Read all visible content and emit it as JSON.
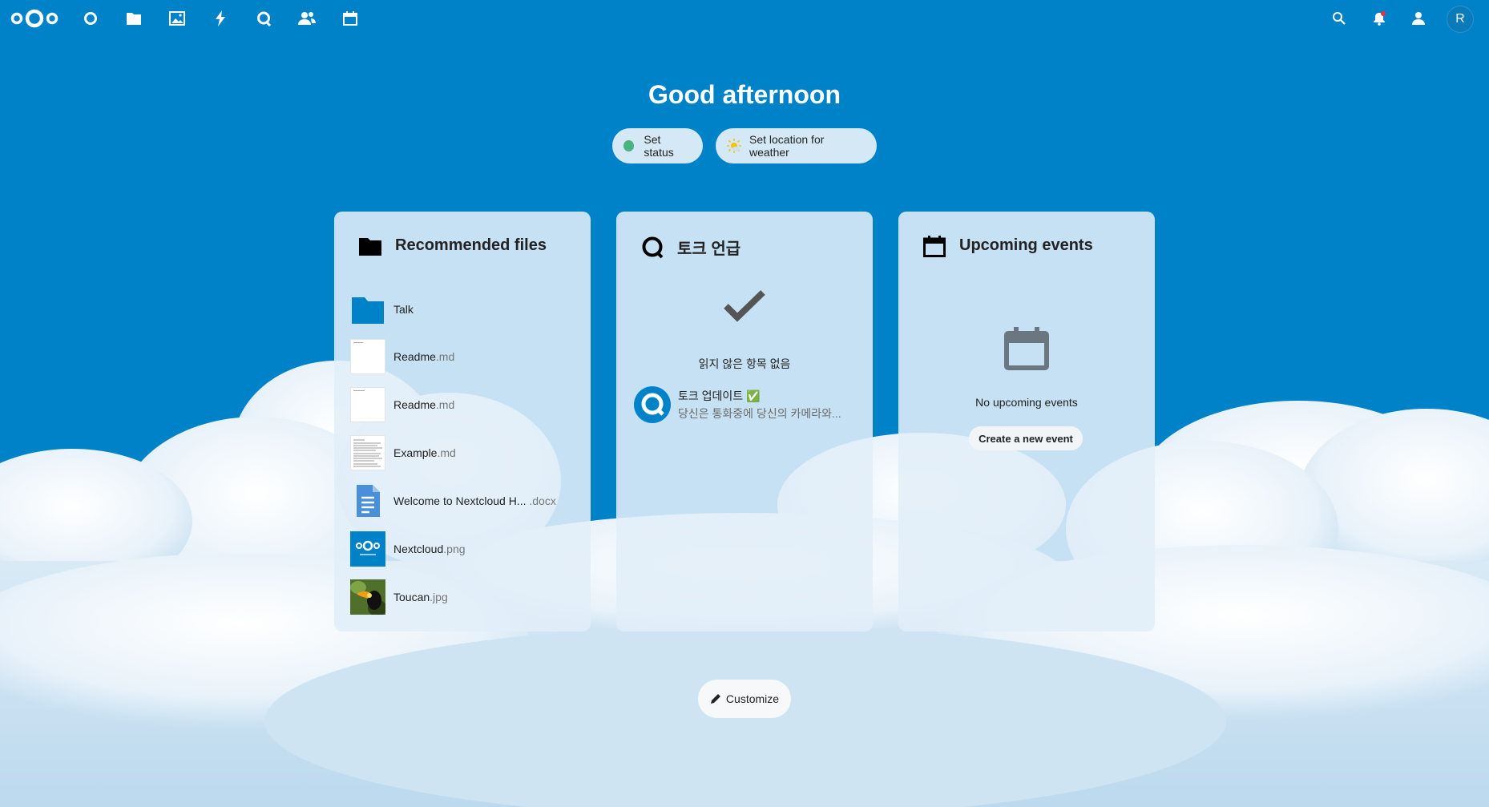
{
  "colors": {
    "brand": "#0082c9",
    "status_online": "#49b382"
  },
  "header": {
    "logo": "nextcloud-logo",
    "nav_icons": [
      "dashboard-icon",
      "files-icon",
      "photos-icon",
      "activity-icon",
      "talk-icon",
      "contacts-icon",
      "calendar-icon"
    ],
    "right_icons": [
      "search-icon",
      "notifications-icon",
      "contacts-menu-icon"
    ],
    "avatar_initial": "R"
  },
  "greeting": "Good afternoon",
  "status_buttons": {
    "set_status": "Set status",
    "set_location": "Set location for weather"
  },
  "widgets": {
    "recommended": {
      "title": "Recommended files",
      "files": [
        {
          "name": "Talk",
          "ext": "",
          "thumb": "folder"
        },
        {
          "name": "Readme",
          "ext": ".md",
          "thumb": "doc-blank"
        },
        {
          "name": "Readme",
          "ext": ".md",
          "thumb": "doc-blank"
        },
        {
          "name": "Example",
          "ext": ".md",
          "thumb": "doc-text"
        },
        {
          "name": "Welcome to Nextcloud H...",
          "ext": " .docx",
          "thumb": "docx"
        },
        {
          "name": "Nextcloud",
          "ext": ".png",
          "thumb": "nextcloud-png"
        },
        {
          "name": "Toucan",
          "ext": ".jpg",
          "thumb": "toucan-photo"
        }
      ]
    },
    "talk": {
      "title": "토크 언급",
      "empty_text": "읽지 않은 항목 없음",
      "item_title": "토크 업데이트 ✅",
      "item_subtitle": "당신은 통화중에 당신의 카메라와..."
    },
    "events": {
      "title": "Upcoming events",
      "empty_text": "No upcoming events",
      "create_button": "Create a new event"
    }
  },
  "customize_button": "Customize"
}
